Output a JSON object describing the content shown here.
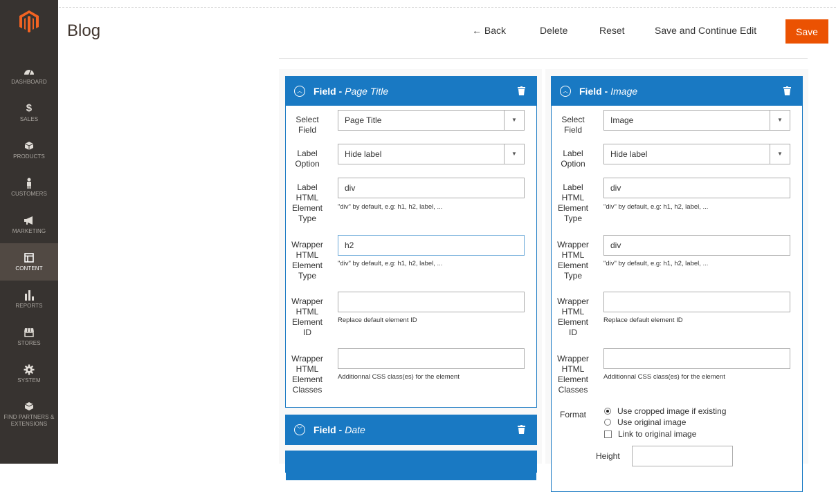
{
  "header": {
    "title": "Blog",
    "back_label": "← Back",
    "delete_label": "Delete",
    "reset_label": "Reset",
    "save_continue_label": "Save and Continue Edit",
    "save_label": "Save"
  },
  "sidebar": {
    "logo_icon": "magento-logo-icon",
    "items": [
      {
        "label": "DASHBOARD",
        "icon": "dashboard-icon"
      },
      {
        "label": "SALES",
        "icon": "dollar-icon"
      },
      {
        "label": "PRODUCTS",
        "icon": "cube-icon"
      },
      {
        "label": "CUSTOMERS",
        "icon": "person-icon"
      },
      {
        "label": "MARKETING",
        "icon": "megaphone-icon"
      },
      {
        "label": "CONTENT",
        "icon": "layout-icon",
        "active": true
      },
      {
        "label": "REPORTS",
        "icon": "bar-chart-icon"
      },
      {
        "label": "STORES",
        "icon": "store-icon"
      },
      {
        "label": "SYSTEM",
        "icon": "gear-icon"
      },
      {
        "label": "FIND PARTNERS & EXTENSIONS",
        "icon": "box-icon"
      }
    ]
  },
  "labels": {
    "select_field": "Select Field",
    "label_option": "Label Option",
    "label_html_type": "Label HTML Element Type",
    "wrapper_html_type": "Wrapper HTML Element Type",
    "wrapper_html_id": "Wrapper HTML Element ID",
    "wrapper_html_classes": "Wrapper HTML Element Classes",
    "format": "Format",
    "height": "Height"
  },
  "notes": {
    "div_default": "\"div\" by default, e.g: h1, h2, label, ...",
    "replace_id": "Replace default element ID",
    "css_classes": "Additionnal CSS class(es) for the element"
  },
  "left_column": {
    "field1": {
      "prefix": "Field -",
      "name": "Page Title",
      "select_field": "Page Title",
      "label_option": "Hide label",
      "label_html_type": "div",
      "wrapper_html_type": "h2",
      "wrapper_html_id": "",
      "wrapper_html_classes": ""
    },
    "field2": {
      "prefix": "Field -",
      "name": "Date"
    }
  },
  "right_column": {
    "field1": {
      "prefix": "Field -",
      "name": "Image",
      "select_field": "Image",
      "label_option": "Hide label",
      "label_html_type": "div",
      "wrapper_html_type": "div",
      "wrapper_html_id": "",
      "wrapper_html_classes": "",
      "format_options": [
        {
          "label": "Use cropped image if existing",
          "type": "radio",
          "checked": true
        },
        {
          "label": "Use original image",
          "type": "radio",
          "checked": false
        },
        {
          "label": "Link to original image",
          "type": "checkbox",
          "checked": false
        }
      ],
      "height": ""
    }
  },
  "colors": {
    "accent": "#1979c3",
    "save": "#eb5202",
    "sidebar": "#373330"
  }
}
